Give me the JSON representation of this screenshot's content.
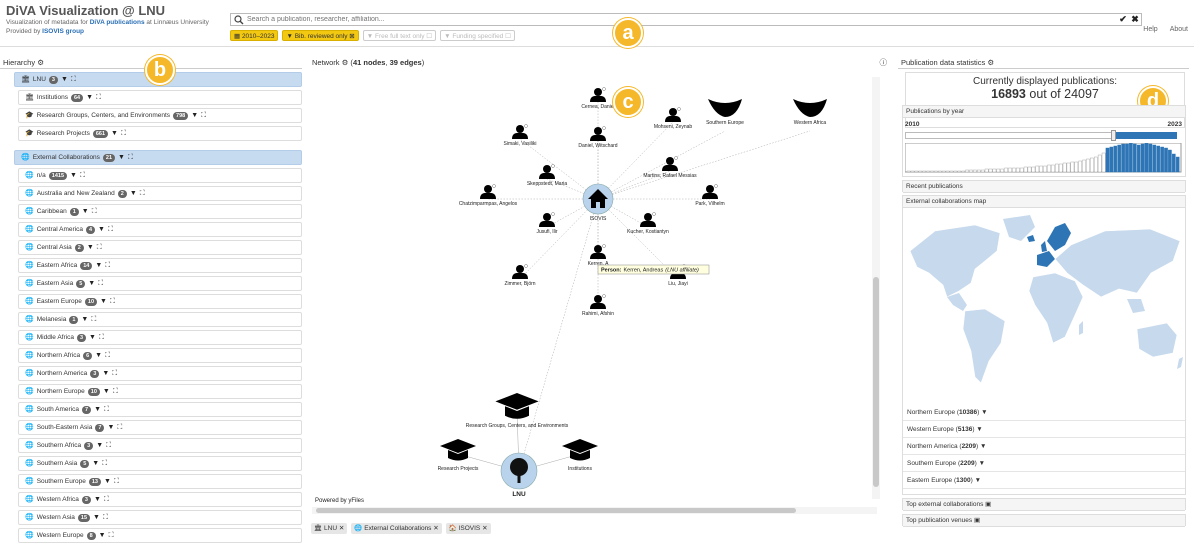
{
  "header": {
    "title": "DiVA Visualization @ LNU",
    "subtitle_pre": "Visualization of metadata for ",
    "subtitle_link": "DiVA publications",
    "subtitle_post": " at Linnæus University",
    "provided_pre": "Provided by ",
    "provided_link": "ISOVIS group",
    "search_placeholder": "Search a publication, researcher, affiliation...",
    "search_submit": "✔",
    "search_clear": "✖",
    "filters": [
      {
        "label": "▦ 2010–2023",
        "active": true
      },
      {
        "label": "▼ Bib. reviewed only ⊠",
        "active": true
      },
      {
        "label": "▼ Free full text only ☐",
        "active": false
      },
      {
        "label": "▼ Funding specified ☐",
        "active": false
      }
    ],
    "help": "Help",
    "about": "About"
  },
  "callouts": {
    "a": "a",
    "b": "b",
    "c": "c",
    "d": "d"
  },
  "hierarchy": {
    "title": "Hierarchy",
    "groups": [
      {
        "label": "LNU",
        "count": "3",
        "icon": "🏛",
        "items": [
          {
            "label": "Institutions",
            "count": "64",
            "icon": "🏛"
          },
          {
            "label": "Research Groups, Centers, and Environments",
            "count": "798",
            "icon": "🎓"
          },
          {
            "label": "Research Projects",
            "count": "661",
            "icon": "🎓"
          }
        ]
      },
      {
        "label": "External Collaborations",
        "count": "21",
        "icon": "🌐",
        "items": [
          {
            "label": "n/a",
            "count": "1415",
            "icon": "🌐"
          },
          {
            "label": "Australia and New Zealand",
            "count": "2",
            "icon": "🌐"
          },
          {
            "label": "Caribbean",
            "count": "1",
            "icon": "🌐"
          },
          {
            "label": "Central America",
            "count": "4",
            "icon": "🌐"
          },
          {
            "label": "Central Asia",
            "count": "2",
            "icon": "🌐"
          },
          {
            "label": "Eastern Africa",
            "count": "14",
            "icon": "🌐"
          },
          {
            "label": "Eastern Asia",
            "count": "5",
            "icon": "🌐"
          },
          {
            "label": "Eastern Europe",
            "count": "10",
            "icon": "🌐"
          },
          {
            "label": "Melanesia",
            "count": "1",
            "icon": "🌐"
          },
          {
            "label": "Middle Africa",
            "count": "3",
            "icon": "🌐"
          },
          {
            "label": "Northern Africa",
            "count": "6",
            "icon": "🌐"
          },
          {
            "label": "Northern America",
            "count": "3",
            "icon": "🌐"
          },
          {
            "label": "Northern Europe",
            "count": "10",
            "icon": "🌐"
          },
          {
            "label": "South America",
            "count": "7",
            "icon": "🌐"
          },
          {
            "label": "South-Eastern Asia",
            "count": "7",
            "icon": "🌐"
          },
          {
            "label": "Southern Africa",
            "count": "3",
            "icon": "🌐"
          },
          {
            "label": "Southern Asia",
            "count": "5",
            "icon": "🌐"
          },
          {
            "label": "Southern Europe",
            "count": "13",
            "icon": "🌐"
          },
          {
            "label": "Western Africa",
            "count": "3",
            "icon": "🌐"
          },
          {
            "label": "Western Asia",
            "count": "15",
            "icon": "🌐"
          },
          {
            "label": "Western Europe",
            "count": "8",
            "icon": "🌐"
          }
        ]
      }
    ]
  },
  "network": {
    "title": "Network",
    "meta_nodes": "41 nodes",
    "meta_edges": "39 edges",
    "powered": "Powered by yFiles",
    "tooltip_label": "Person:",
    "tooltip_name": "Kerren, Andreas",
    "tooltip_aff": "(LNU affiliate)",
    "center": "ISOVIS",
    "root": "LNU",
    "people": [
      "Cernea, Daniel",
      "Simaki, Vasiliki",
      "Mohseni, Zeynab",
      "Daniel, Witschard",
      "Skeppstedt, Maria",
      "Martins, Rafael Messias",
      "Chatzimparmpas, Angelos",
      "Park, Vilhelm",
      "Jusufi, Ilir",
      "Kucher, Kostiantyn",
      "Kerren, A",
      "Zimmer, Björn",
      "Liu, Jiayi",
      "Rahimi, Afshin"
    ],
    "regions": [
      "Southern Europe",
      "Western Africa"
    ],
    "org_nodes": [
      "Research Groups, Centers, and Environments",
      "Research Projects",
      "Institutions"
    ],
    "breadcrumbs": [
      "🏛 LNU ✕",
      "🌐 External Collaborations ✕",
      "🏠 ISOVIS ✕"
    ]
  },
  "stats": {
    "title": "Publication data statistics",
    "counter_label": "Currently displayed publications:",
    "displayed": "16893",
    "total_text": " out of 24097",
    "years_title": "Publications by year",
    "year_start": "2010",
    "year_end": "2023",
    "recent_title": "Recent publications",
    "map_title": "External collaborations map",
    "top_regions": [
      {
        "name": "Northern Europe",
        "count": "10386"
      },
      {
        "name": "Western Europe",
        "count": "5136"
      },
      {
        "name": "Northern America",
        "count": "2209"
      },
      {
        "name": "Southern Europe",
        "count": "2209"
      },
      {
        "name": "Eastern Europe",
        "count": "1300"
      }
    ],
    "top_collab_title": "Top external collaborations",
    "top_venues_title": "Top publication venues"
  },
  "colors": {
    "accent": "#f2c811",
    "callout": "#f5b82a",
    "highlight": "#c6daf0",
    "bar": "#2e75b6",
    "map_land": "#c7d9ec",
    "map_strong": "#2e75b6"
  }
}
